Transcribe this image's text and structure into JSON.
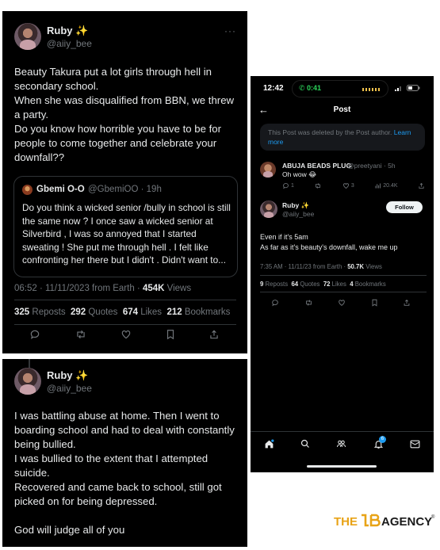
{
  "tweet1": {
    "name": "Ruby",
    "sparkle": "✨",
    "handle": "@aiiy_bee",
    "more": "···",
    "text": "Beauty Takura put a lot girls through hell in secondary school.\nWhen she was disqualified from BBN, we threw a party.\nDo you know how horrible you have to be for people to come together and celebrate your downfall??",
    "quote": {
      "name": "Gbemi O-O",
      "handle": "@GbemiOO",
      "time": "· 19h",
      "text": "Do you think a wicked senior /bully in school is still the same now ? I once saw a wicked senior at Silverbird , I was so annoyed that I started sweating ! She put me through hell . I felt like confronting her there but I didn't . Didn't want to..."
    },
    "timestamp": "06:52 · 11/11/2023 from Earth · ",
    "views_count": "454K",
    "views_label": " Views",
    "stats": [
      {
        "count": "325",
        "label": " Reposts"
      },
      {
        "count": "292",
        "label": " Quotes"
      },
      {
        "count": "674",
        "label": " Likes"
      },
      {
        "count": "212",
        "label": " Bookmarks"
      }
    ]
  },
  "tweet2": {
    "name": "Ruby",
    "sparkle": "✨",
    "handle": "@aiiy_bee",
    "text": "I was battling abuse at home. Then I went to boarding school and had to deal with constantly being bullied.\nI was bullied to the extent that I attempted suicide.\nRecovered and came back to school, still got picked on for being depressed.\n\nGod will judge all of you"
  },
  "phone": {
    "status_time": "12:42",
    "call_time": "0:41",
    "header_title": "Post",
    "back_arrow": "←",
    "deleted_notice": "This Post was deleted by the Post author.",
    "deleted_link": "Learn more",
    "reply": {
      "name": "ABUJA BEADS PLUG",
      "handle": "@preetyani",
      "time": "· 5h",
      "text": "Oh wow 😂",
      "replies": "1",
      "likes": "3",
      "views": "20.4K"
    },
    "main": {
      "name": "Ruby",
      "sparkle": "✨",
      "handle": "@aiiy_bee",
      "follow_label": "Follow",
      "text": "Even if it's 5am\nAs far as it's beauty's downfall, wake me up",
      "timestamp": "7:35 AM · 11/11/23 from Earth · ",
      "views_count": "50.7K",
      "views_label": " Views",
      "stats": [
        {
          "count": "9",
          "label": " Reposts"
        },
        {
          "count": "64",
          "label": " Quotes"
        },
        {
          "count": "72",
          "label": " Likes"
        },
        {
          "count": "4",
          "label": " Bookmarks"
        }
      ]
    },
    "notification_badge": "6"
  },
  "watermark": {
    "part1": "THE",
    "part2": "AGENCY",
    "registered": "®"
  },
  "colors": {
    "background": "#000000",
    "text": "#e7e9ea",
    "muted": "#71767b",
    "border": "#2f3336",
    "link": "#1d9bf0",
    "watermark_gold": "#e8a317"
  }
}
